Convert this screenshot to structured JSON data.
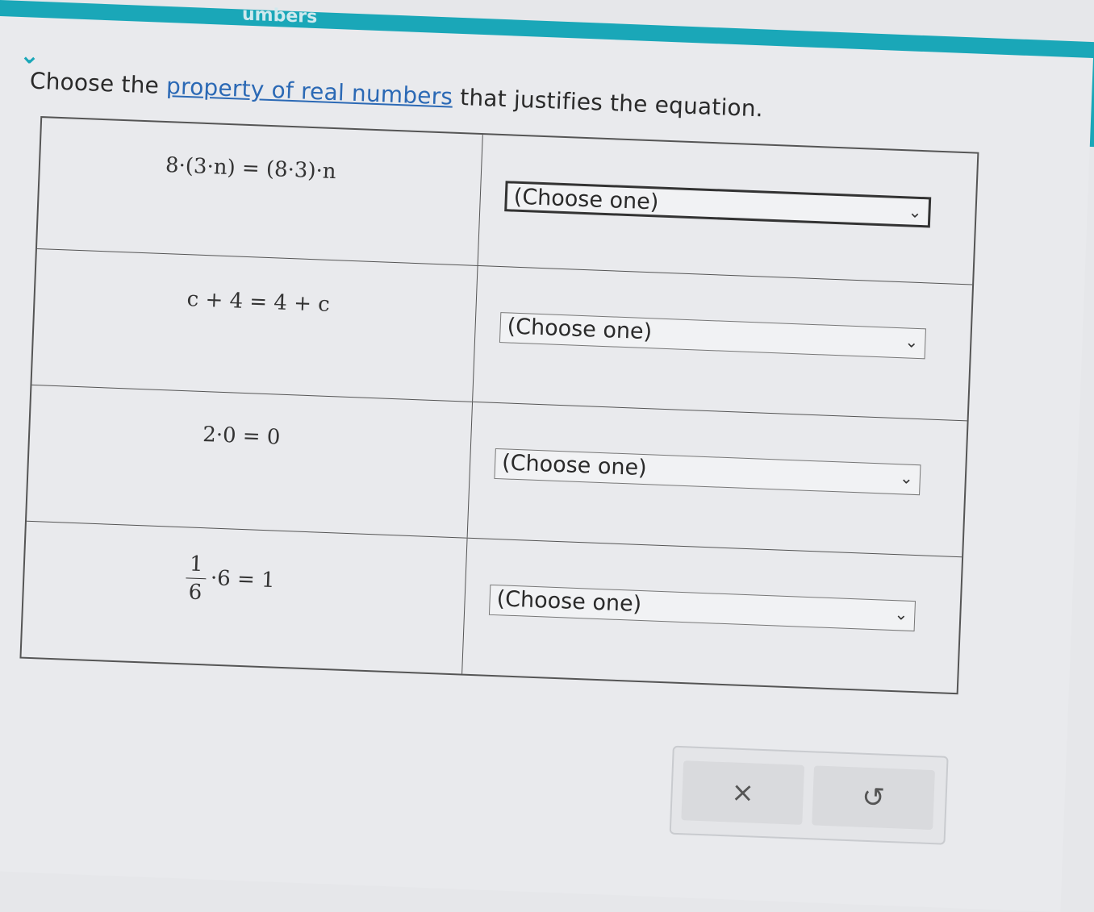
{
  "header": {
    "title": "umbers"
  },
  "question": {
    "prefix": "Choose the ",
    "link_text": "property of real numbers",
    "suffix": " that justifies the equation."
  },
  "rows": [
    {
      "equation_text": "8·(3·n) = (8·3)·n",
      "select_value": "(Choose one)"
    },
    {
      "equation_text": "c + 4 = 4 + c",
      "select_value": "(Choose one)"
    },
    {
      "equation_text": "2·0 = 0",
      "select_value": "(Choose one)"
    },
    {
      "equation_numerator": "1",
      "equation_denominator": "6",
      "equation_rest": "·6 = 1",
      "select_value": "(Choose one)"
    }
  ],
  "actions": {
    "clear_icon": "×",
    "undo_icon": "↺"
  },
  "icons": {
    "collapse": "chevron-down-icon",
    "dropdown": "chevron-down-icon",
    "clear": "close-icon",
    "undo": "undo-icon"
  },
  "colors": {
    "accent": "#1aa7b8",
    "link": "#2b69b5"
  }
}
